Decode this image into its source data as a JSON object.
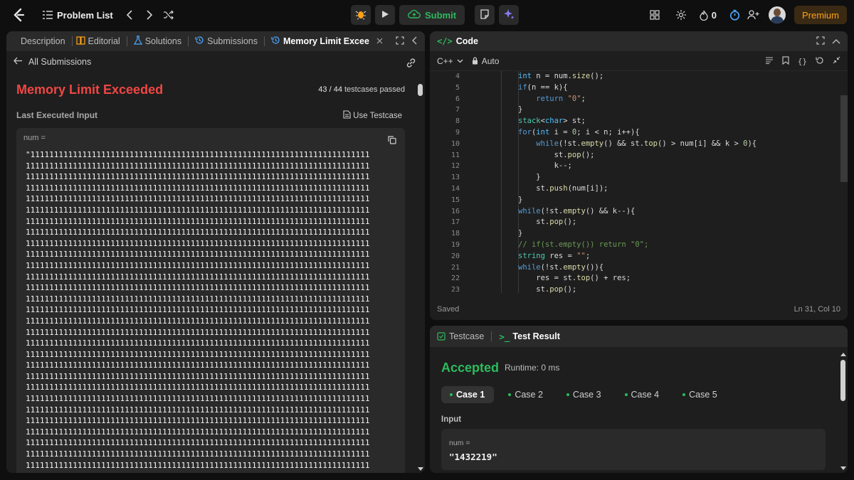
{
  "topbar": {
    "problem_list_label": "Problem List",
    "submit_label": "Submit",
    "streak_count": "0",
    "premium_label": "Premium"
  },
  "left_tabs": [
    {
      "label": "Description"
    },
    {
      "label": "Editorial"
    },
    {
      "label": "Solutions"
    },
    {
      "label": "Submissions"
    },
    {
      "label": "Memory Limit Excee"
    }
  ],
  "submission": {
    "back_label": "All Submissions",
    "status": "Memory Limit Exceeded",
    "passed": "43 / 44",
    "passed_suffix": "testcases passed",
    "last_input_label": "Last Executed Input",
    "use_testcase_label": "Use Testcase",
    "var_label": "num =",
    "first_line": "\"111111111111111111111111111111111111111111111111111111111111111111111111",
    "repeat_line": "1111111111111111111111111111111111111111111111111111111111111111111111111"
  },
  "code_panel": {
    "title": "Code",
    "language": "C++",
    "mode": "Auto",
    "saved_label": "Saved",
    "cursor_pos": "Ln 31, Col 10",
    "line_numbers": [
      "4",
      "5",
      "6",
      "7",
      "8",
      "9",
      "10",
      "11",
      "12",
      "13",
      "14",
      "15",
      "16",
      "17",
      "18",
      "19",
      "20",
      "21",
      "22",
      "23"
    ]
  },
  "test_panel": {
    "tab_testcase": "Testcase",
    "tab_result": "Test Result",
    "status": "Accepted",
    "runtime": "Runtime: 0 ms",
    "cases": [
      "Case 1",
      "Case 2",
      "Case 3",
      "Case 4",
      "Case 5"
    ],
    "input_label": "Input",
    "var_label": "num =",
    "var_value": "\"1432219\""
  },
  "colors": {
    "accent_green": "#2cbb5d",
    "error_red": "#ef4743",
    "premium_orange": "#ffa116",
    "active_tab_blue": "#4ea8ff"
  }
}
